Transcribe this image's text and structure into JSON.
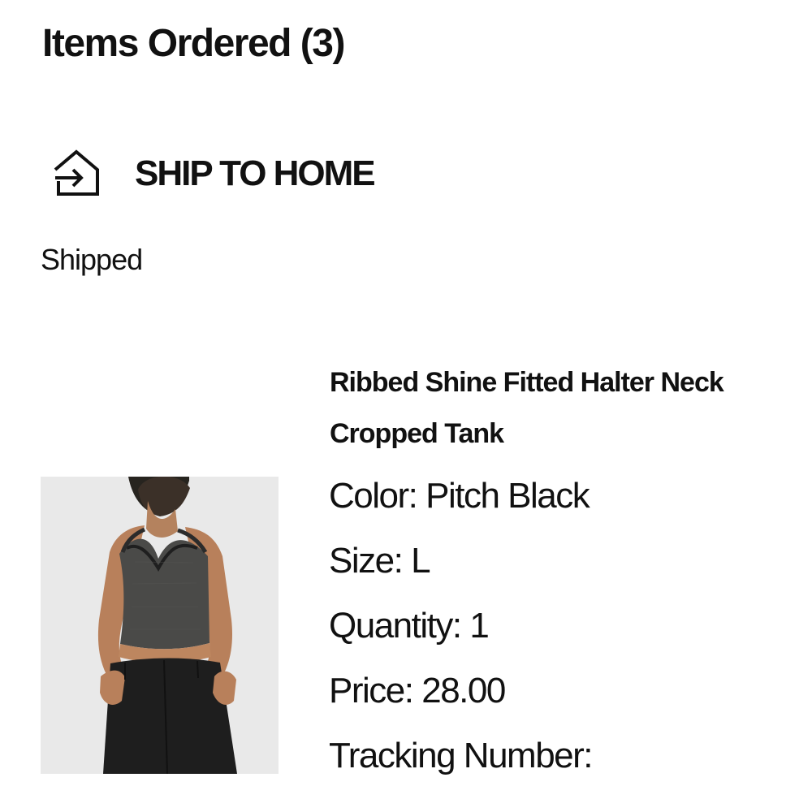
{
  "items_ordered": {
    "title": "Items Ordered (3)"
  },
  "fulfillment": {
    "icon": "home-arrow-icon",
    "label": "SHIP TO HOME",
    "status": "Shipped"
  },
  "item": {
    "name": "Ribbed Shine Fitted Halter Neck Cropped Tank",
    "image": "product-photo",
    "color": {
      "label": "Color:",
      "value": "Pitch Black"
    },
    "size": {
      "label": "Size:",
      "value": "L"
    },
    "quantity": {
      "label": "Quantity:",
      "value": "1"
    },
    "price": {
      "label": "Price:",
      "value": "28.00"
    },
    "tracking": {
      "label": "Tracking Number:",
      "value": ""
    }
  }
}
